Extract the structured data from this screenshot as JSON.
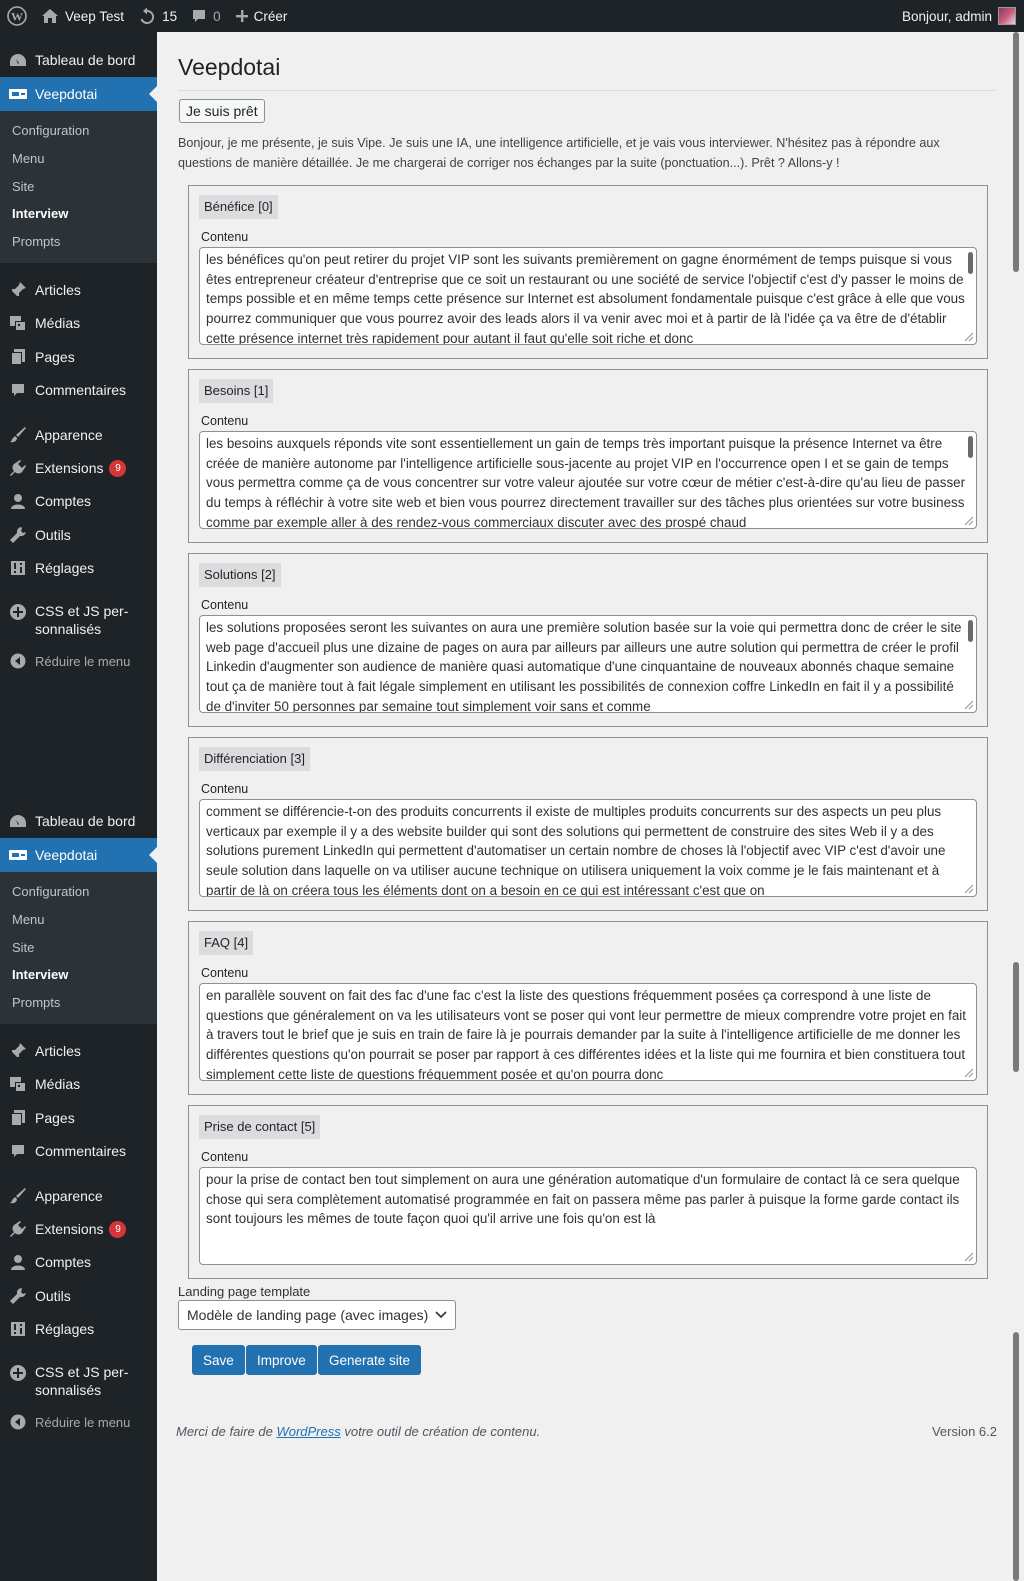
{
  "adminbar": {
    "site_name": "Veep Test",
    "updates_count": "15",
    "comments_count": "0",
    "new_label": "Créer",
    "greeting": "Bonjour, admin"
  },
  "sidebar": {
    "dashboard": "Tableau de bord",
    "plugin": "Veepdotai",
    "submenu": [
      "Configuration",
      "Menu",
      "Site",
      "Interview",
      "Prompts"
    ],
    "active_submenu": "Interview",
    "posts": "Articles",
    "media": "Médias",
    "pages": "Pages",
    "comments": "Commentaires",
    "appearance": "Apparence",
    "plugins": "Extensions",
    "plugins_badge": "9",
    "users": "Comptes",
    "tools": "Outils",
    "settings": "Réglages",
    "custom_css_line1": "CSS et JS per-",
    "custom_css_line2": "sonnalisés",
    "collapse": "Réduire le menu"
  },
  "main": {
    "title": "Veepdotai",
    "ready_button": "Je suis prêt",
    "intro": "Bonjour, je me présente, je suis Vipe. Je suis une IA, une intelligence artificielle, et je vais vous interviewer. N'hésitez pas à répondre aux questions de manière détaillée. Je me chargerai de corriger nos échanges par la suite (ponctuation...). Prêt ? Allons-y !",
    "content_label": "Contenu",
    "sections": [
      {
        "title": "Bénéfice [0]",
        "text": "les bénéfices qu'on peut retirer du projet VIP sont les suivants premièrement on gagne énormément de temps puisque si vous êtes entrepreneur créateur d'entreprise que ce soit un restaurant ou une société de service l'objectif c'est d'y passer le moins de temps possible et en même temps cette présence sur Internet est absolument fondamentale puisque c'est grâce à elle que vous pourrez communiquer que vous pourrez avoir des leads alors il va venir avec moi et à partir de là l'idée ça va être de d'établir cette présence internet très rapidement pour autant il faut qu'elle soit riche et donc"
      },
      {
        "title": "Besoins [1]",
        "text": "les besoins auxquels réponds vite sont essentiellement un gain de temps très important puisque la présence Internet va être créée de manière autonome par l'intelligence artificielle sous-jacente au projet VIP en l'occurrence open I et se gain de temps vous permettra comme ça de vous concentrer sur votre valeur ajoutée sur votre cœur de métier c'est-à-dire qu'au lieu de passer du temps à réfléchir à votre site web et bien vous pourrez directement travailler sur des tâches plus orientées sur votre business comme par exemple aller à des rendez-vous commerciaux discuter avec des prospé chaud"
      },
      {
        "title": "Solutions [2]",
        "text": "les solutions proposées seront les suivantes on aura une première solution basée sur la voie qui permettra donc de créer le site web page d'accueil plus une dizaine de pages on aura par ailleurs par ailleurs une autre solution qui permettra de créer le profil Linkedin d'augmenter son audience de manière quasi automatique d'une cinquantaine de nouveaux abonnés chaque semaine tout ça de manière tout à fait légale simplement en utilisant les possibilités de connexion coffre LinkedIn en fait il y a possibilité de d'inviter 50 personnes par semaine tout simplement voir sans et comme"
      },
      {
        "title": "Différenciation [3]",
        "text": "comment se différencie-t-on des produits concurrents il existe de multiples produits concurrents sur des aspects un peu plus verticaux par exemple il y a des website builder qui sont des solutions qui permettent de construire des sites Web il y a des solutions purement LinkedIn qui permettent d'automatiser un certain nombre de choses là l'objectif avec VIP c'est d'avoir une seule solution dans laquelle on va utiliser aucune technique on utilisera uniquement la voix comme je le fais maintenant et à partir de là on créera tous les éléments dont on a besoin en ce qui est intéressant c'est que on"
      },
      {
        "title": "FAQ [4]",
        "text": "en parallèle souvent on fait des fac d'une fac c'est la liste des questions fréquemment posées ça correspond à une liste de questions que généralement on va les utilisateurs vont se poser qui vont leur permettre de mieux comprendre votre projet en fait à travers tout le brief que je suis en train de faire là je pourrais demander par la suite à l'intelligence artificielle de me donner les différentes questions qu'on pourrait se poser par rapport à ces différentes idées et la liste qui me fournira et bien constituera tout simplement cette liste de questions fréquemment posée et qu'on pourra donc"
      },
      {
        "title": "Prise de contact [5]",
        "text": "pour la prise de contact ben tout simplement on aura une génération automatique d'un formulaire de contact là ce sera quelque chose qui sera complètement automatisé programmée en fait on passera même pas parler à puisque la forme garde contact ils sont toujours les mêmes de toute façon quoi qu'il arrive une fois qu'on est là"
      }
    ],
    "template_label": "Landing page template",
    "template_value": "Modèle de landing page (avec images)",
    "save_button": "Save",
    "improve_button": "Improve",
    "generate_button": "Generate site"
  },
  "footer": {
    "thanks_prefix": "Merci de faire de ",
    "thanks_link": "WordPress",
    "thanks_suffix": " votre outil de création de contenu.",
    "version": "Version 6.2"
  }
}
